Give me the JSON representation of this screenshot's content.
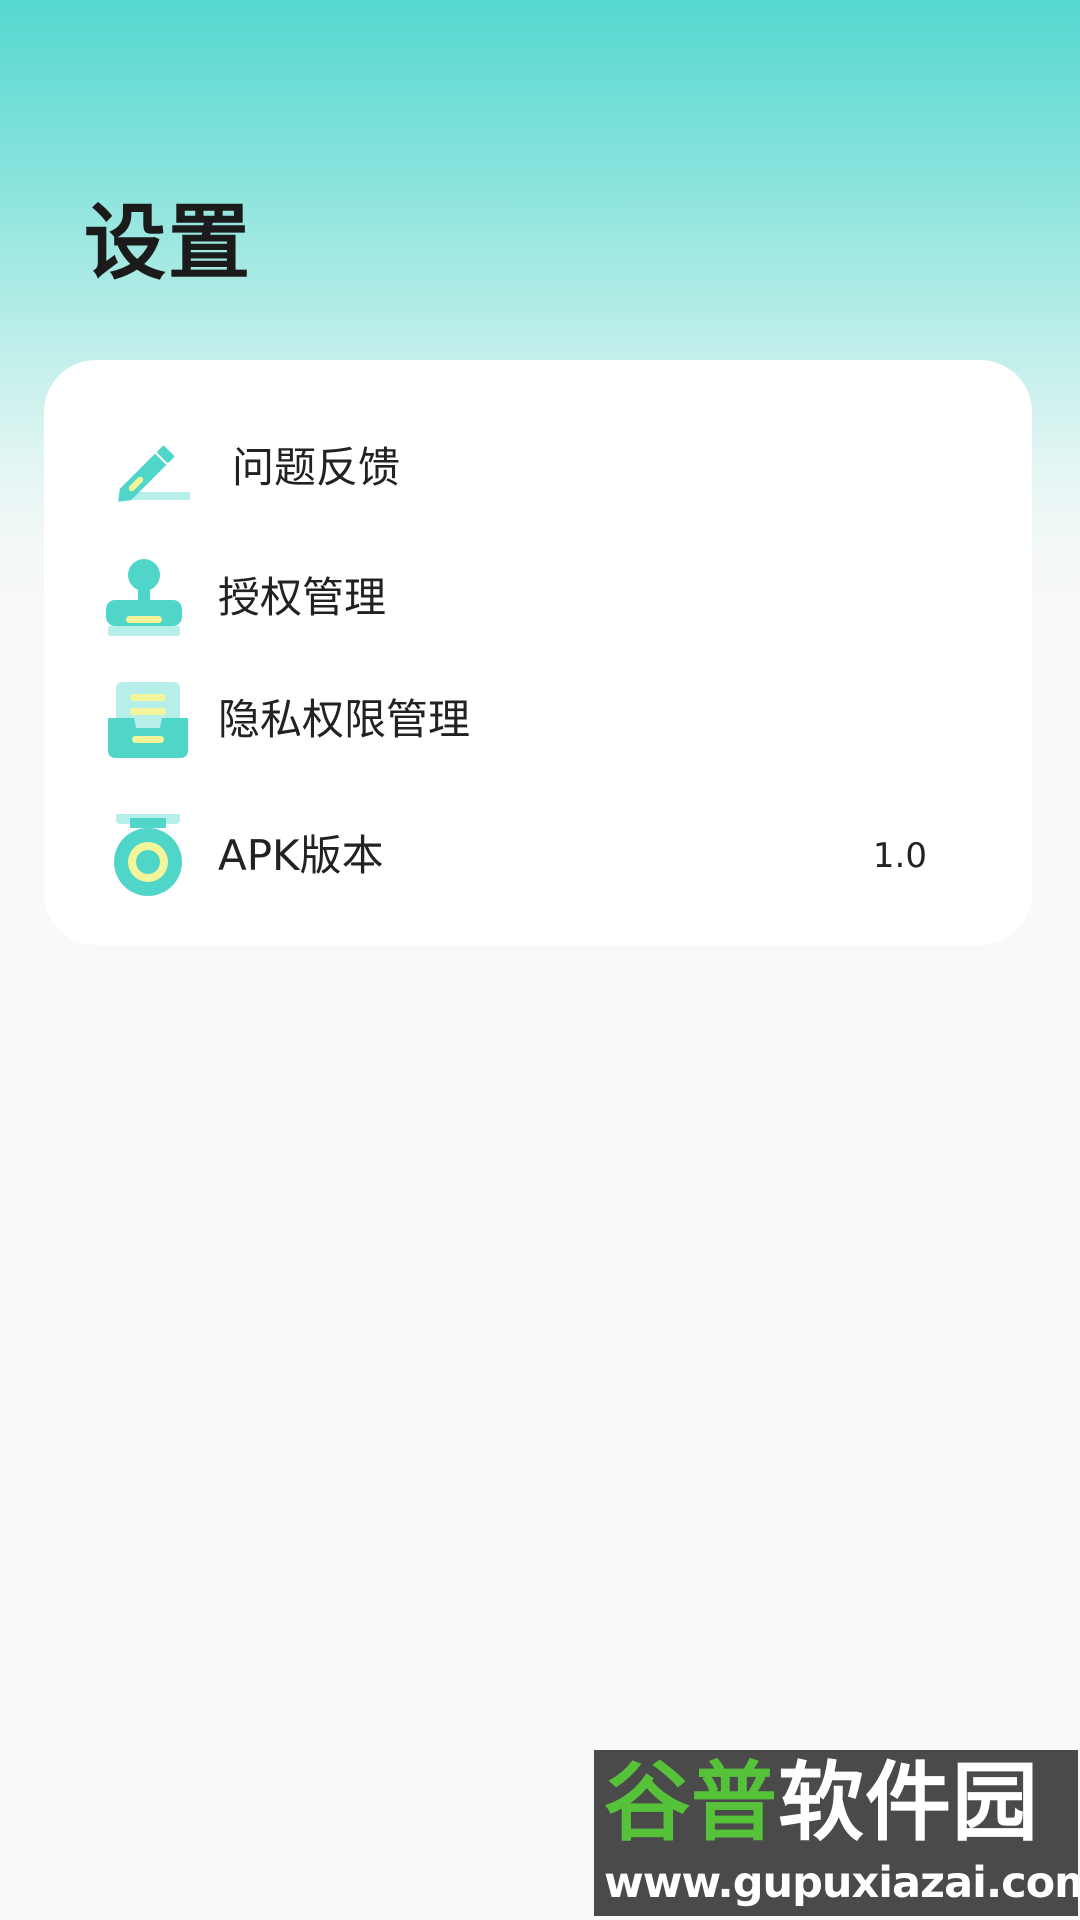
{
  "page": {
    "title": "设置"
  },
  "settings": {
    "items": [
      {
        "label": "问题反馈",
        "icon": "edit-pencil-icon"
      },
      {
        "label": "授权管理",
        "icon": "user-stamp-icon"
      },
      {
        "label": "隐私权限管理",
        "icon": "document-tray-icon"
      },
      {
        "label": "APK版本",
        "icon": "version-medal-icon",
        "value": "1.0"
      }
    ]
  },
  "watermark": {
    "name_part1": "谷普",
    "name_part2": "软件园",
    "url": "www.gupuxiazai.com"
  },
  "colors": {
    "accent": "#4fd6c8",
    "accent_light": "#b6efea",
    "highlight": "#f3f59a",
    "header_gradient_top": "#55d8cf",
    "background": "#f9f9f9",
    "card": "#ffffff",
    "text": "#222222"
  }
}
